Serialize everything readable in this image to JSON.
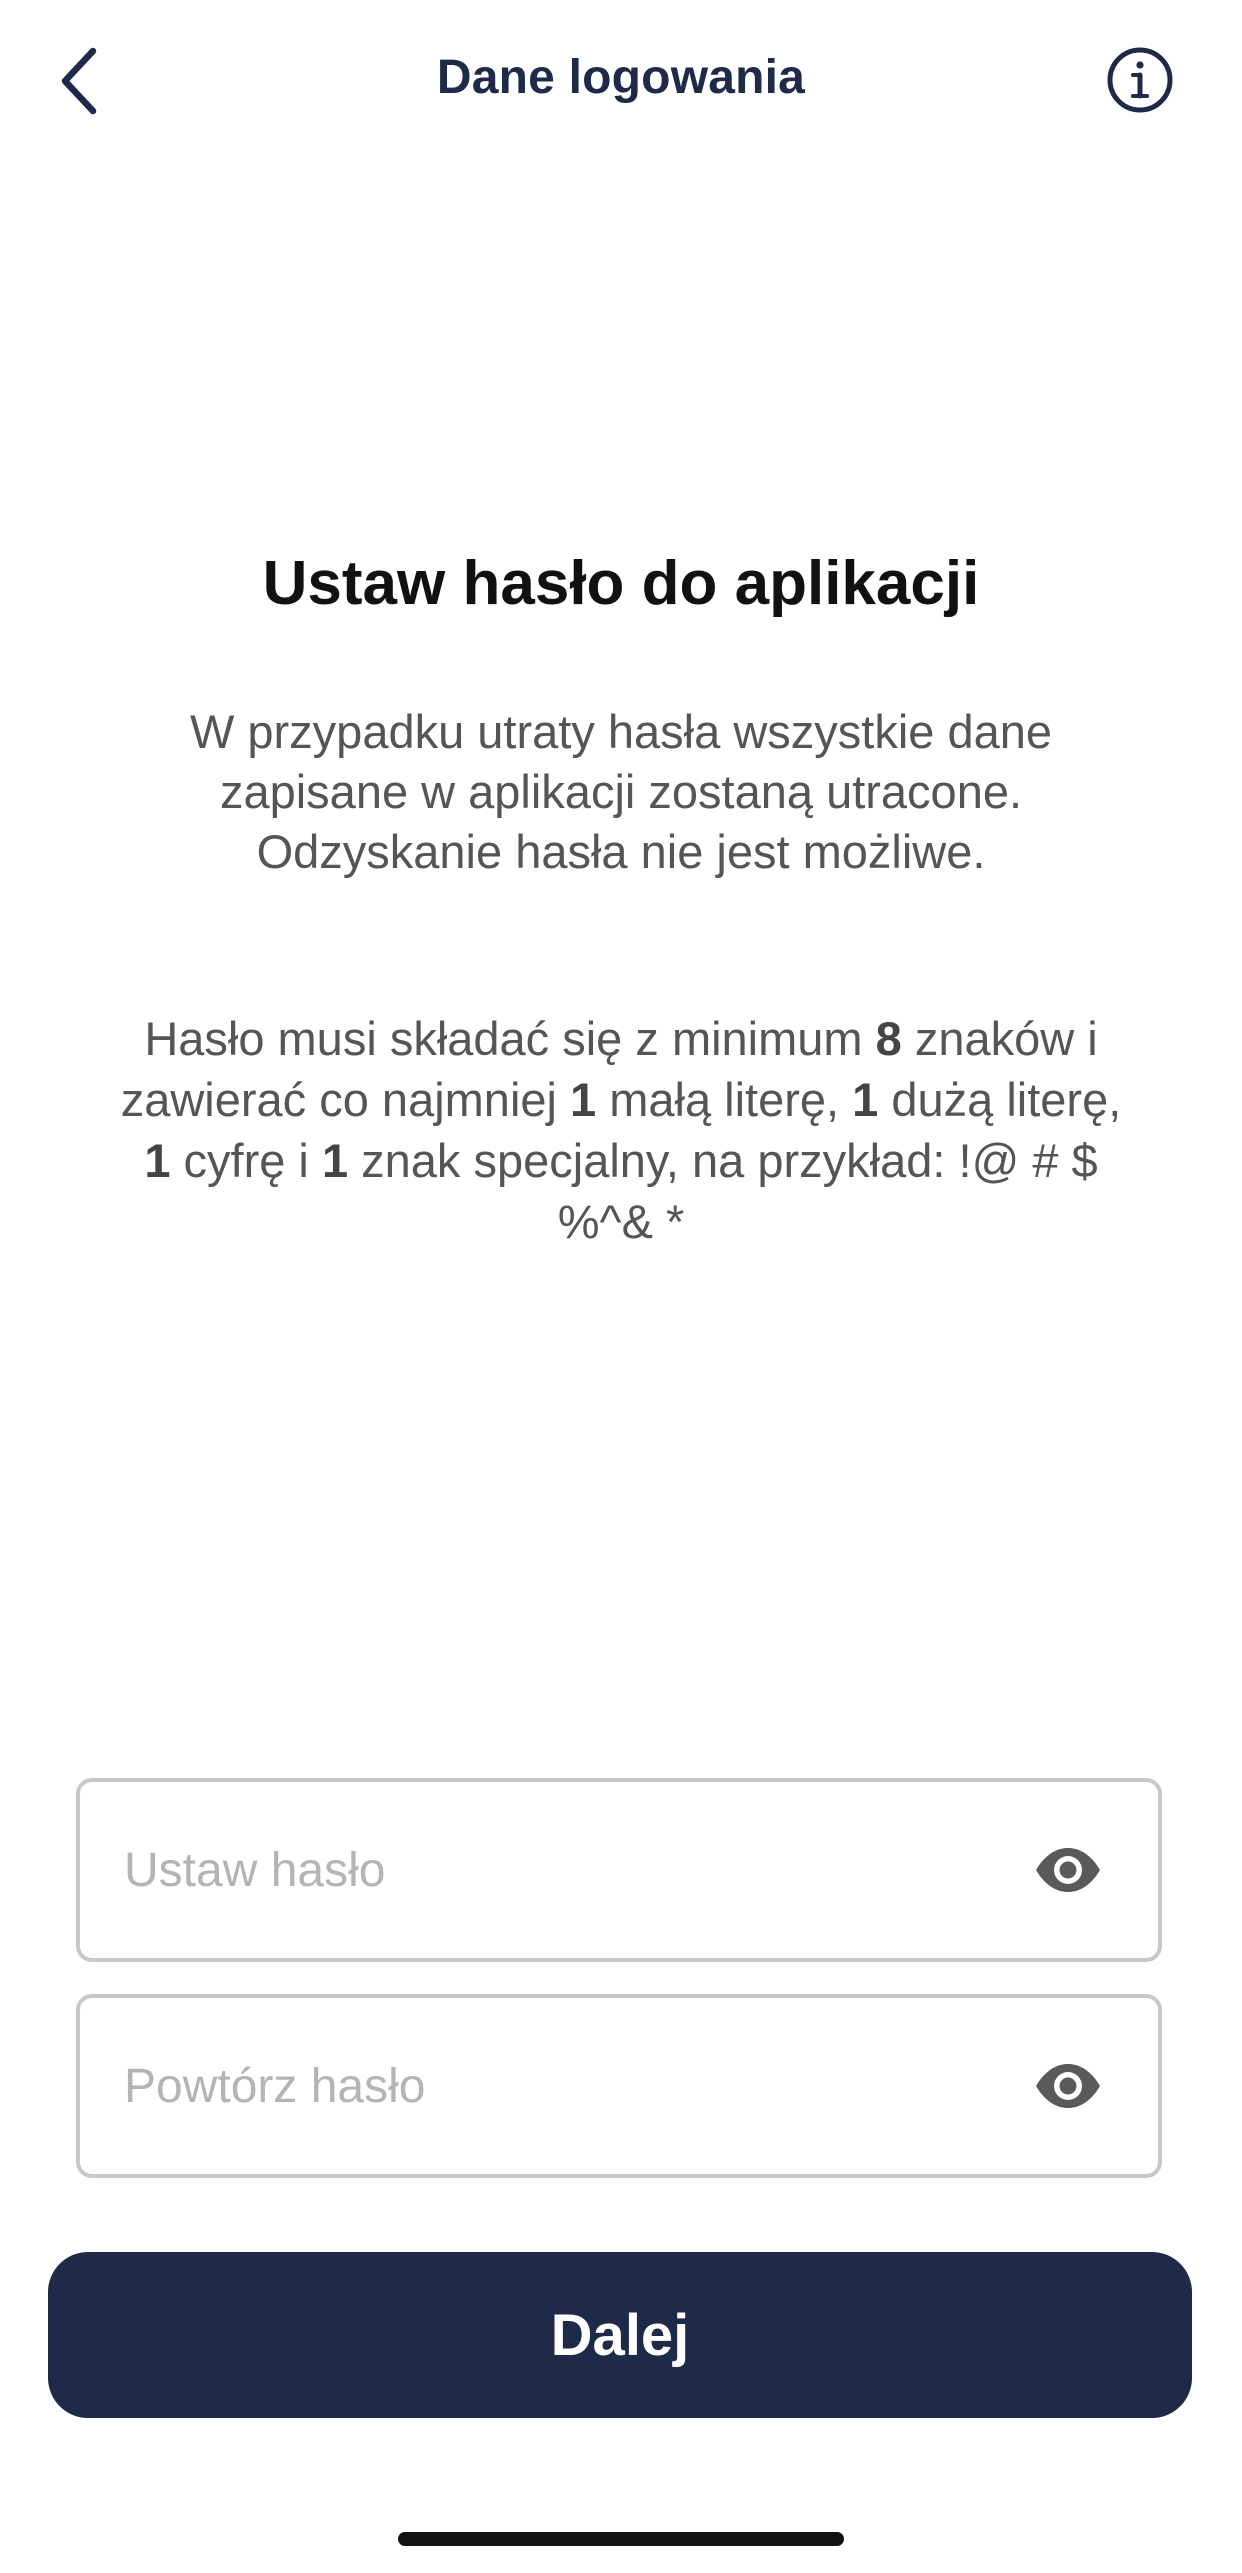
{
  "header": {
    "title": "Dane logowania",
    "back_icon": "chevron-left-icon",
    "info_icon": "info-circle-icon"
  },
  "content": {
    "title": "Ustaw hasło do aplikacji",
    "warning_lines": [
      "W przypadku utraty hasła wszystkie dane",
      "zapisane w aplikacji zostaną utracone.",
      "Odzyskanie hasła nie jest możliwe."
    ],
    "rules": {
      "l1_a": "Hasło musi składać się z minimum ",
      "l1_b": "8",
      "l1_c": " znaków i",
      "l2_a": "zawierać co najmniej ",
      "l2_b": "1",
      "l2_c": " małą literę, ",
      "l2_d": "1",
      "l2_e": " dużą literę,",
      "l3_a": "1",
      "l3_b": " cyfrę i ",
      "l3_c": "1",
      "l3_d": " znak specjalny, na przykład: !@ # $",
      "l4": "%^& *"
    }
  },
  "form": {
    "password": {
      "placeholder": "Ustaw hasło",
      "value": "",
      "icon": "eye-icon"
    },
    "confirm": {
      "placeholder": "Powtórz hasło",
      "value": "",
      "icon": "eye-icon"
    }
  },
  "actions": {
    "next_label": "Dalej"
  },
  "colors": {
    "primary": "#1e2a47",
    "text_gray": "#555555",
    "placeholder": "#b4b4b4",
    "border": "#c8c8c8"
  }
}
